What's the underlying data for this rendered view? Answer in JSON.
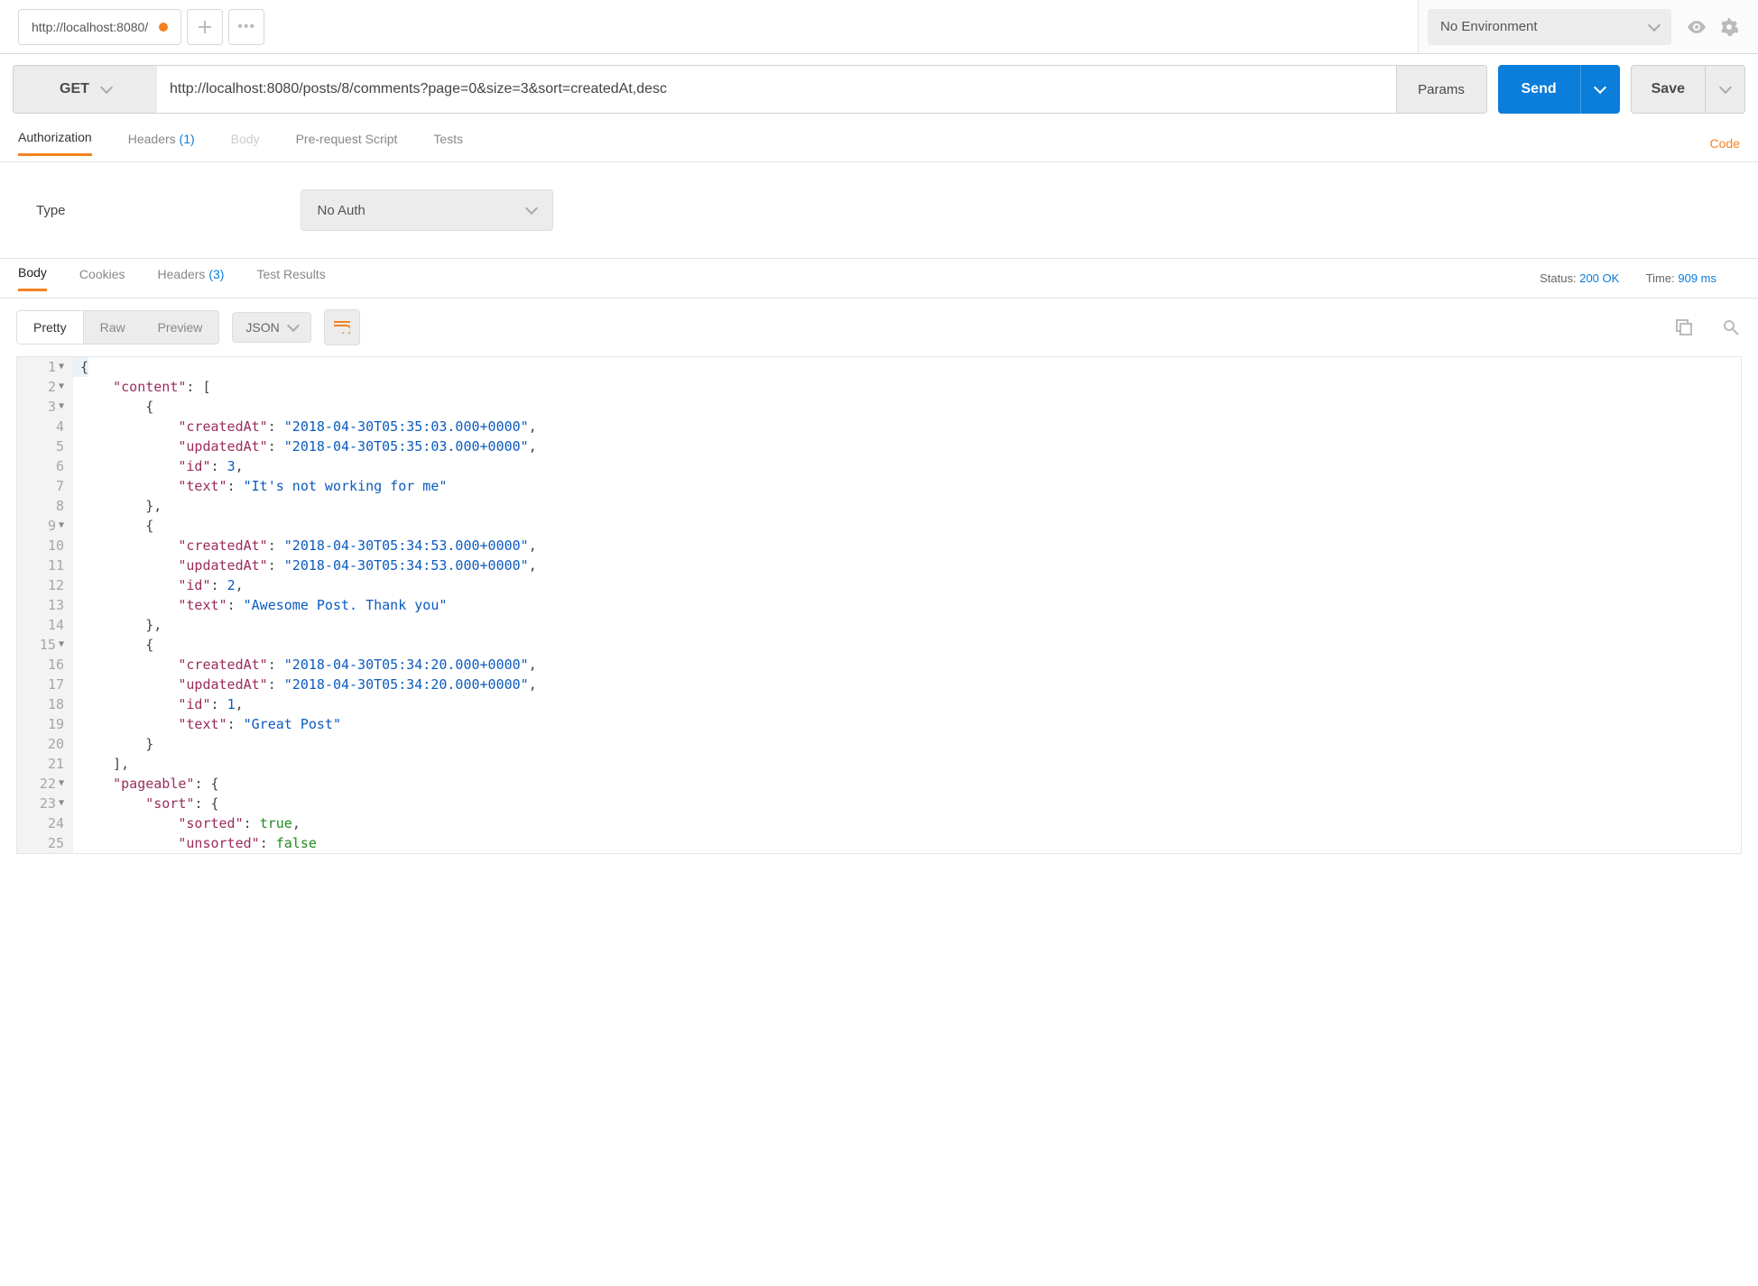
{
  "topbar": {
    "tab_title": "http://localhost:8080/",
    "env_label": "No Environment"
  },
  "request": {
    "method": "GET",
    "url": "http://localhost:8080/posts/8/comments?page=0&size=3&sort=createdAt,desc",
    "params_label": "Params",
    "send_label": "Send",
    "save_label": "Save"
  },
  "req_tabs": {
    "authorization": "Authorization",
    "headers": "Headers",
    "headers_count": "(1)",
    "body": "Body",
    "prerequest": "Pre-request Script",
    "tests": "Tests",
    "code": "Code"
  },
  "auth": {
    "type_label": "Type",
    "type_value": "No Auth"
  },
  "resp_tabs": {
    "body": "Body",
    "cookies": "Cookies",
    "headers": "Headers",
    "headers_count": "(3)",
    "tests": "Test Results",
    "status_label": "Status:",
    "status_value": "200 OK",
    "time_label": "Time:",
    "time_value": "909 ms"
  },
  "body_toolbar": {
    "pretty": "Pretty",
    "raw": "Raw",
    "preview": "Preview",
    "format": "JSON"
  },
  "json": {
    "content": [
      {
        "createdAt": "2018-04-30T05:35:03.000+0000",
        "updatedAt": "2018-04-30T05:35:03.000+0000",
        "id": 3,
        "text": "It's not working for me"
      },
      {
        "createdAt": "2018-04-30T05:34:53.000+0000",
        "updatedAt": "2018-04-30T05:34:53.000+0000",
        "id": 2,
        "text": "Awesome Post. Thank you"
      },
      {
        "createdAt": "2018-04-30T05:34:20.000+0000",
        "updatedAt": "2018-04-30T05:34:20.000+0000",
        "id": 1,
        "text": "Great Post"
      }
    ],
    "pageable_key": "pageable",
    "sort_key": "sort",
    "sorted_key": "sorted",
    "sorted_val": "true",
    "unsorted_key": "unsorted",
    "unsorted_val": "false"
  }
}
